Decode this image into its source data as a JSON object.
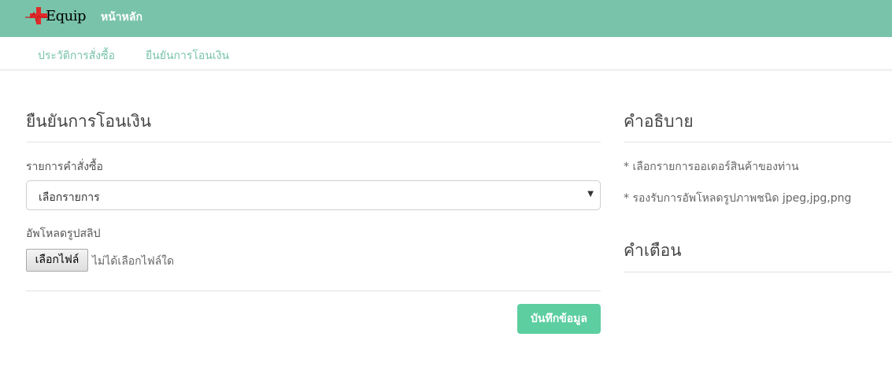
{
  "header": {
    "logo_text": "Equip",
    "nav_home": "หน้าหลัก",
    "bg_color": "#79c3ab"
  },
  "subnav": {
    "order_history": "ประวัติการสั่งซื้อ",
    "confirm_payment": "ยืนยันการโอนเงิน"
  },
  "form": {
    "title": "ยืนยันการโอนเงิน",
    "order_label": "รายการคำสั่งซื้อ",
    "order_select_value": "เลือกรายการ",
    "upload_label": "อัพโหลดรูปสลิป",
    "file_button": "เลือกไฟล์",
    "file_status": "ไม่ได้เลือกไฟล์ใด",
    "save_button": "บันทึกข้อมูล",
    "save_color": "#5ccea0"
  },
  "sidebar": {
    "description_title": "คำอธิบาย",
    "description_items": [
      "* เลือกรายการออเดอร์สินค้าของท่าน",
      "* รองรับการอัพโหลดรูปภาพชนิด jpeg,jpg,png"
    ],
    "warning_title": "คำเตือน"
  }
}
